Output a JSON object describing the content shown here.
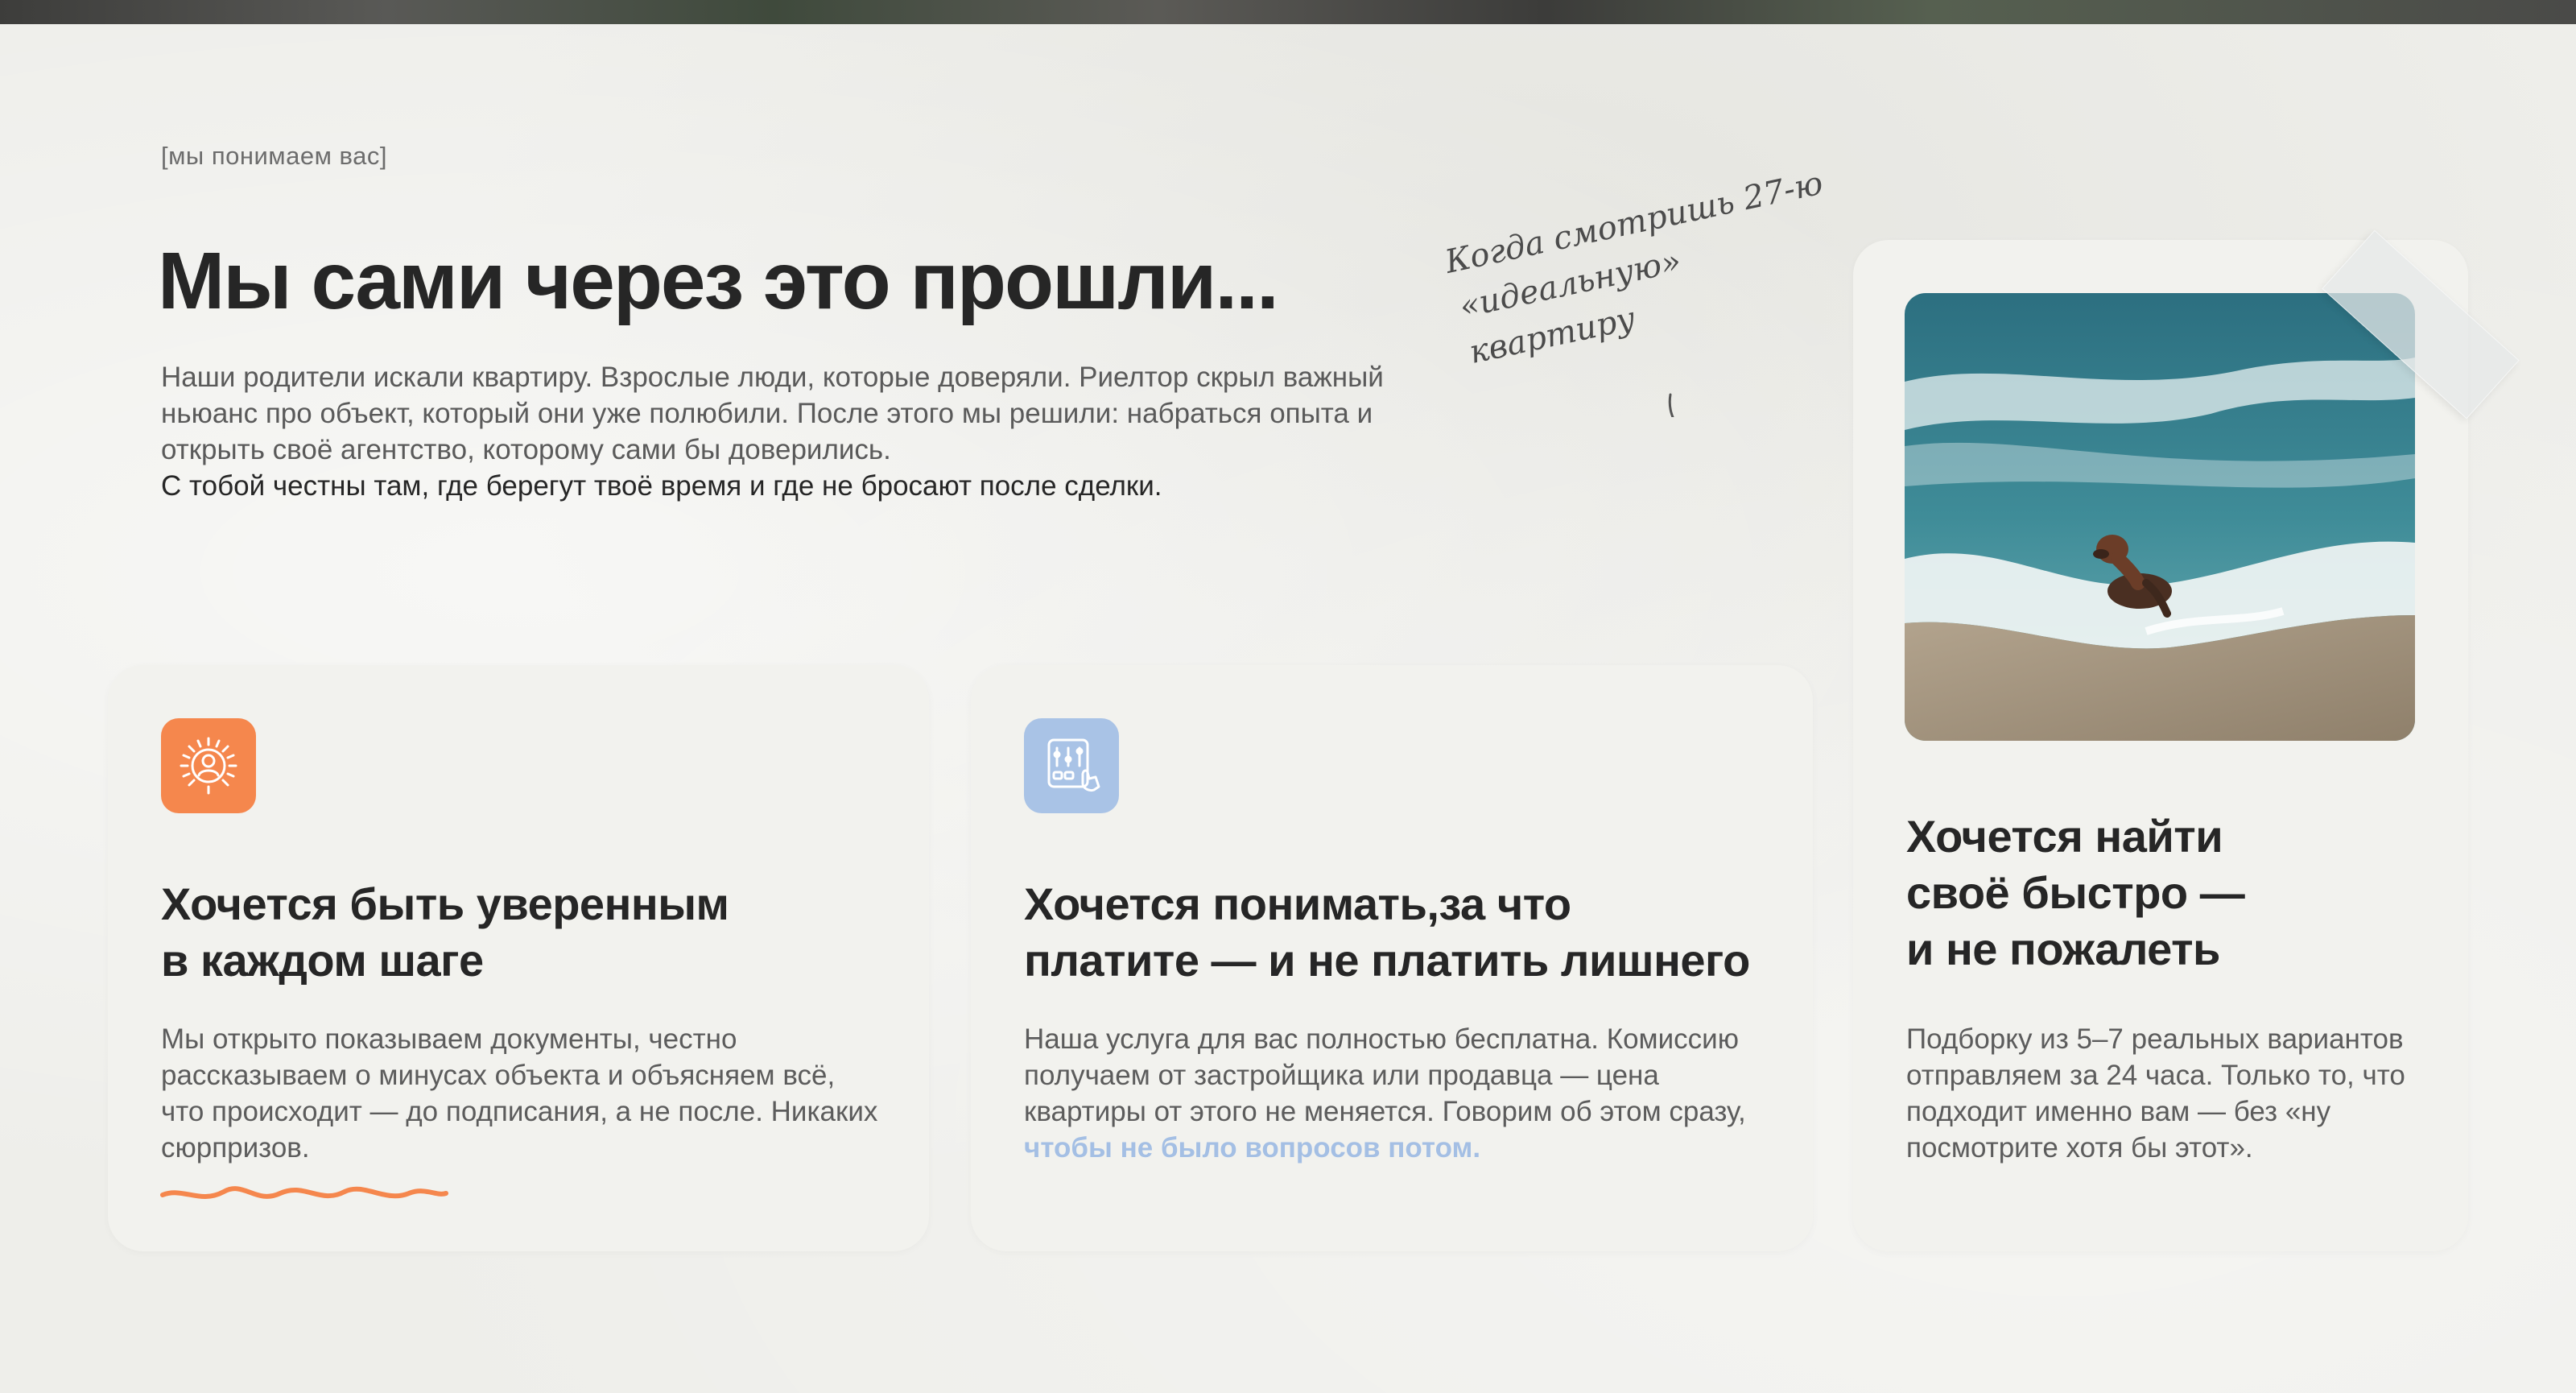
{
  "header": {
    "kicker": "[мы понимаем вас]",
    "title": "Мы сами через это прошли...",
    "intro_muted": "Наши родители искали квартиру. Взрослые люди, которые доверяли. Риелтор скрыл важный ньюанс про объект, который они уже полюбили. После этого мы решили: набраться опыта и открыть своё агентство, которому сами бы доверились.",
    "intro_strong": "С тобой честны там, где берегут твоё время и где не бросают после сделки."
  },
  "handnote": {
    "line1": "Когда смотришь 27-ю",
    "line2": "«идеальную» квартиру"
  },
  "cards": [
    {
      "icon": "person-sun-icon",
      "title_line1": "Хочется быть уверенным",
      "title_line2": "в каждом шаге",
      "text": "Мы открыто показываем документы, честно рассказываем о минусах объекта и объясняем всё, что происходит — до подписания, а не после. Никаких сюрпризов."
    },
    {
      "icon": "calculator-hand-icon",
      "title_line1": "Хочется понимать,за что",
      "title_line2": "платите — и не платить лишнего",
      "text": "Наша услуга для вас полностью бесплатна. Комиссию получаем от застройщика или продавца — цена квартиры от этого не меняется. Говорим об этом сразу,",
      "accent": "чтобы не было вопросов потом."
    },
    {
      "photo": "dog-in-sea-waves-photo",
      "title_line1": "Хочется найти",
      "title_line2": "своё быстро —",
      "title_line3": "и не пожалеть",
      "text": "Подборку из 5–7 реальных вариантов отправляем за 24 часа. Только то, что подходит именно вам — без «ну посмотрите хотя бы этот»."
    }
  ],
  "colors": {
    "background": "#eeeeea",
    "card": "#f2f2ee",
    "orange": "#f5874d",
    "blue": "#a9c3e6",
    "accent_text": "#a4bfe4"
  }
}
